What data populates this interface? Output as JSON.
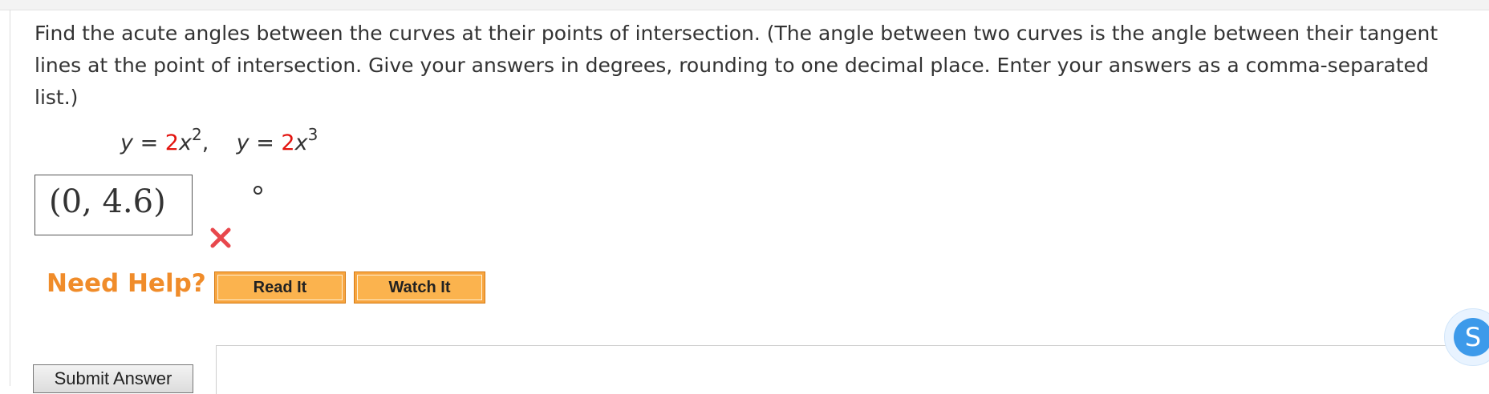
{
  "question": {
    "text": "Find the acute angles between the curves at their points of intersection. (The angle between two curves is the angle between their tangent lines at the point of intersection. Give your answers in degrees, rounding to one decimal place. Enter your answers as a comma-separated list.)"
  },
  "formula": {
    "eq1_lhs": "y",
    "eq1_mid": " = ",
    "eq1_coef": "2",
    "eq1_var": "x",
    "eq1_exp": "2",
    "separator": ",",
    "eq2_lhs": "y",
    "eq2_mid": " = ",
    "eq2_coef": "2",
    "eq2_var": "x",
    "eq2_exp": "3"
  },
  "answer": {
    "value": "(0, 4.6)",
    "unit_symbol": "°",
    "status_icon": "incorrect-x-icon"
  },
  "help": {
    "label": "Need Help?",
    "read_it": "Read It",
    "watch_it": "Watch It"
  },
  "submit": {
    "label": "Submit Answer"
  },
  "badge": {
    "letter": "S"
  },
  "colors": {
    "coefficient_red": "#e3140f",
    "help_orange": "#f08c2a",
    "button_orange": "#fbb34e",
    "incorrect_red": "#e8474c",
    "badge_blue": "#3d9aea"
  }
}
